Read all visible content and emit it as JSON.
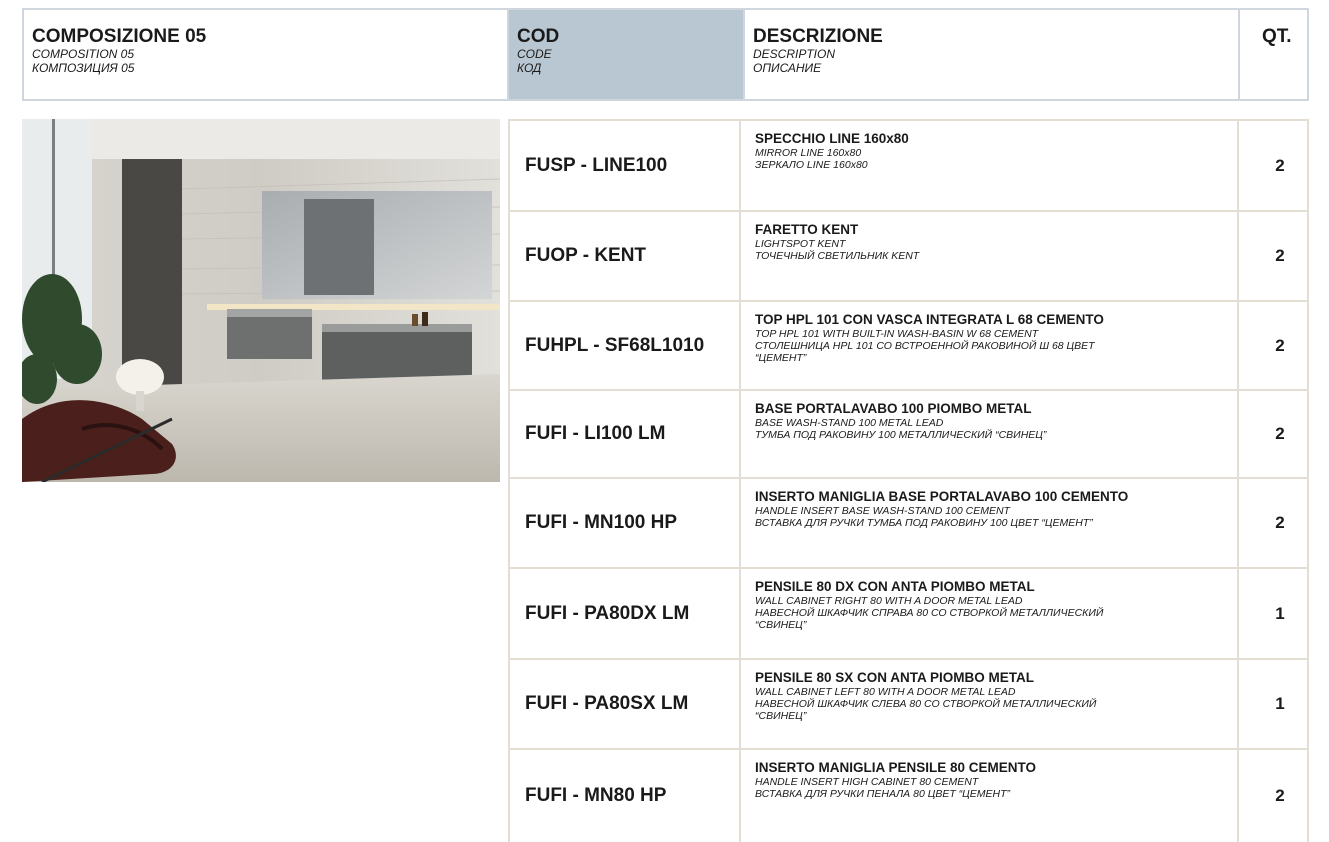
{
  "header": {
    "composition": {
      "title": "COMPOSIZIONE 05",
      "en": "COMPOSITION 05",
      "ru": "КОМПОЗИЦИЯ 05"
    },
    "code": {
      "title": "COD",
      "en": "CODE",
      "ru": "КОД"
    },
    "description": {
      "title": "DESCRIZIONE",
      "en": "DESCRIPTION",
      "ru": "ОПИСАНИЕ"
    },
    "qty": {
      "title": "QT."
    }
  },
  "items": [
    {
      "code": "FUSP - LINE100",
      "title": "SPECCHIO LINE 160x80",
      "lines": [
        "MIRROR LINE 160x80",
        "ЗЕРКАЛО LINE 160x80"
      ],
      "qty": "2"
    },
    {
      "code": "FUOP - KENT",
      "title": "FARETTO KENT",
      "lines": [
        "LIGHTSPOT KENT",
        "ТОЧЕЧНЫЙ СВЕТИЛЬНИК KENT"
      ],
      "qty": "2"
    },
    {
      "code": "FUHPL - SF68L1010",
      "title": "TOP HPL 101 CON VASCA INTEGRATA L 68 CEMENTO",
      "lines": [
        "TOP HPL 101 WITH BUILT-IN WASH-BASIN W 68 CEMENT",
        "СТОЛЕШНИЦА HPL 101 СО ВСТРОЕННОЙ РАКОВИНОЙ Ш 68 ЦВЕТ",
        "“ЦЕМЕНТ”"
      ],
      "qty": "2"
    },
    {
      "code": "FUFI - LI100 LM",
      "title": "BASE PORTALAVABO 100 PIOMBO METAL",
      "lines": [
        "BASE WASH-STAND 100 METAL LEAD",
        "ТУМБА ПОД РАКОВИНУ 100 МЕТАЛЛИЧЕСКИЙ “СВИНЕЦ”"
      ],
      "qty": "2"
    },
    {
      "code": "FUFI - MN100 HP",
      "title": "INSERTO MANIGLIA BASE PORTALAVABO 100 CEMENTO",
      "lines": [
        "HANDLE INSERT BASE WASH-STAND 100 CEMENT",
        "ВСТАВКА ДЛЯ РУЧКИ ТУМБА ПОД РАКОВИНУ 100 ЦВЕТ “ЦЕМЕНТ”"
      ],
      "qty": "2"
    },
    {
      "code": "FUFI - PA80DX LM",
      "title": "PENSILE 80 DX CON ANTA PIOMBO METAL",
      "lines": [
        "WALL CABINET RIGHT 80 WITH A DOOR METAL LEAD",
        "НАВЕСНОЙ ШКАФЧИК СПРАВА 80 СО СТВОРКОЙ МЕТАЛЛИЧЕСКИЙ",
        "“СВИНЕЦ”"
      ],
      "qty": "1"
    },
    {
      "code": "FUFI - PA80SX LM",
      "title": "PENSILE 80 SX CON ANTA PIOMBO METAL",
      "lines": [
        "WALL CABINET LEFT 80 WITH A DOOR METAL LEAD",
        "НАВЕСНОЙ ШКАФЧИК СЛЕВА 80 СО СТВОРКОЙ МЕТАЛЛИЧЕСКИЙ",
        "“СВИНЕЦ”"
      ],
      "qty": "1"
    },
    {
      "code": "FUFI - MN80 HP",
      "title": "INSERTO MANIGLIA PENSILE 80 CEMENTO",
      "lines": [
        "HANDLE INSERT HIGH CABINET 80 CEMENT",
        "ВСТАВКА ДЛЯ РУЧКИ ПЕНАЛА 80 ЦВЕТ “ЦЕМЕНТ”"
      ],
      "qty": "2"
    }
  ],
  "colors": {
    "header_border": "#cfd6dd",
    "code_header_bg": "#b9c7d2",
    "row_border": "#e3ddd3"
  }
}
